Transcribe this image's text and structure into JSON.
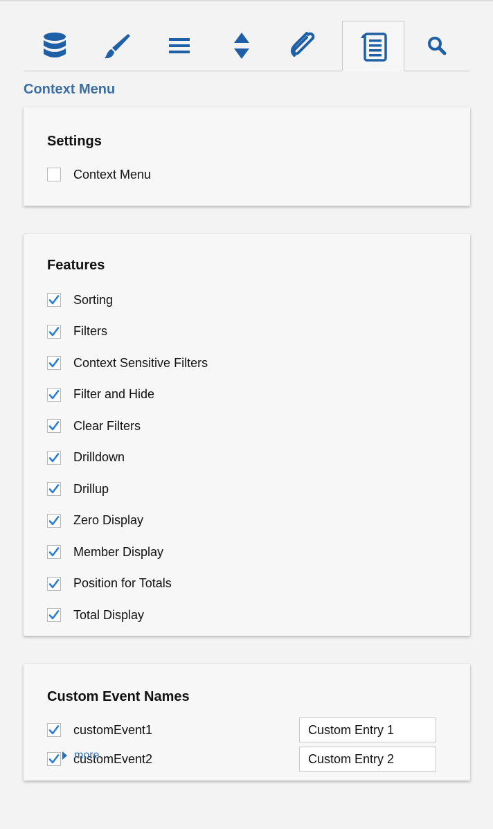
{
  "tabs": [
    {
      "name": "tab-data",
      "icon": "database-icon"
    },
    {
      "name": "tab-style",
      "icon": "brush-icon"
    },
    {
      "name": "tab-menu",
      "icon": "hamburger-icon"
    },
    {
      "name": "tab-sort",
      "icon": "sort-arrows-icon"
    },
    {
      "name": "tab-attach",
      "icon": "paperclip-icon"
    },
    {
      "name": "tab-context-menu",
      "icon": "list-icon",
      "active": true
    },
    {
      "name": "tab-search",
      "icon": "search-icon"
    }
  ],
  "section_title": "Context Menu",
  "settings": {
    "title": "Settings",
    "context_menu": {
      "label": "Context Menu",
      "checked": false
    }
  },
  "features": {
    "title": "Features",
    "items": [
      {
        "label": "Sorting",
        "checked": true
      },
      {
        "label": "Filters",
        "checked": true
      },
      {
        "label": "Context Sensitive Filters",
        "checked": true
      },
      {
        "label": "Filter and Hide",
        "checked": true
      },
      {
        "label": "Clear Filters",
        "checked": true
      },
      {
        "label": "Drilldown",
        "checked": true
      },
      {
        "label": "Drillup",
        "checked": true
      },
      {
        "label": "Zero Display",
        "checked": true
      },
      {
        "label": "Member Display",
        "checked": true
      },
      {
        "label": "Position for Totals",
        "checked": true
      },
      {
        "label": "Total Display",
        "checked": true
      }
    ]
  },
  "custom_events": {
    "title": "Custom Event Names",
    "items": [
      {
        "label": "customEvent1",
        "checked": true,
        "value": "Custom Entry 1"
      },
      {
        "label": "customEvent2",
        "checked": true,
        "value": "Custom Entry 2"
      }
    ],
    "more_label": "more"
  },
  "colors": {
    "accent": "#1f5fa6",
    "title": "#3b6ea5",
    "check": "#2b7fd3"
  }
}
